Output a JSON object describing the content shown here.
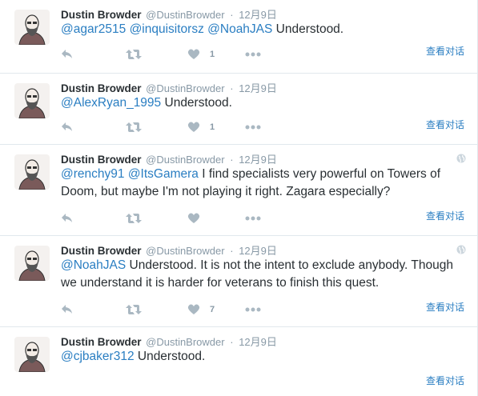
{
  "author": {
    "name": "Dustin Browder",
    "handle": "@DustinBrowder",
    "separator": "·"
  },
  "view_conversation": "查看对话",
  "tweets": [
    {
      "date": "12月9日",
      "mentions": [
        "@agar2515",
        "@inquisitorsz",
        "@NoahJAS"
      ],
      "text": "Understood.",
      "like_count": "1"
    },
    {
      "date": "12月9日",
      "mentions": [
        "@AlexRyan_1995"
      ],
      "text": "Understood.",
      "like_count": "1"
    },
    {
      "date": "12月9日",
      "mentions": [
        "@renchy91",
        "@ItsGamera"
      ],
      "text": "I find specialists very powerful on Towers of Doom, but maybe I'm not playing it right. Zagara especially?",
      "like_count": ""
    },
    {
      "date": "12月9日",
      "mentions": [
        "@NoahJAS"
      ],
      "text": "Understood. It is not the intent to exclude anybody. Though we understand it is harder for veterans to finish this quest.",
      "like_count": "7"
    },
    {
      "date": "12月9日",
      "mentions": [
        "@cjbaker312"
      ],
      "text": "Understood.",
      "like_count": ""
    }
  ],
  "icons": {
    "reply": "reply-icon",
    "retweet": "retweet-icon",
    "like": "heart-icon",
    "more": "more-icon",
    "globe": "globe-icon"
  },
  "colors": {
    "link": "#2a7ec2",
    "muted": "#8899a6",
    "icon": "#aab8c2",
    "divider": "#e1e8ed"
  }
}
